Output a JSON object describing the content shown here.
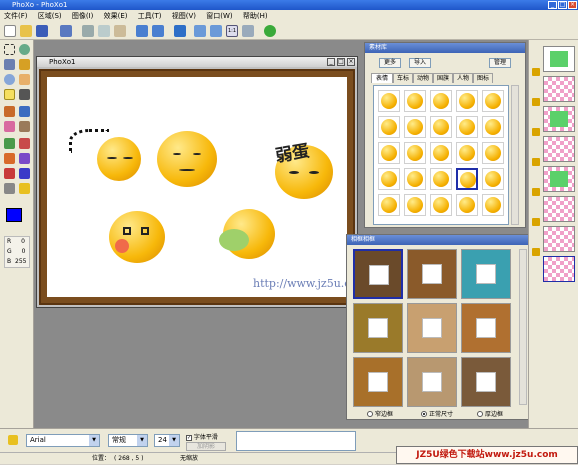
{
  "window": {
    "title": "PhoXo - PhoXo1"
  },
  "menu": [
    "文件(F)",
    "区域(S)",
    "图像(I)",
    "效果(E)",
    "工具(T)",
    "视图(V)",
    "窗口(W)",
    "帮助(H)"
  ],
  "document": {
    "title": "PhoXo1",
    "watermark": "http://www.jz5u.com"
  },
  "colors": {
    "accent": "#2f68d8",
    "frame_wood": "#7a4d1e",
    "face_yellow": "#f7b80a",
    "selection": "#1f2ea8"
  },
  "left_panel": {
    "r_label": "R",
    "r_value": "0",
    "g_label": "G",
    "g_value": "0",
    "b_label": "B",
    "b_value": "255"
  },
  "material_panel": {
    "title": "素材库",
    "buttons": {
      "more": "更多",
      "import": "导入",
      "manage": "管理"
    },
    "tabs": [
      "表情",
      "车标",
      "动物",
      "国旗",
      "人物",
      "图标"
    ]
  },
  "frame_panel": {
    "title": "相框相框",
    "radios": [
      "窄边框",
      "正常尺寸",
      "厚边框"
    ],
    "selected_radio": "正常尺寸"
  },
  "bottom_bar": {
    "font": "Arial",
    "style": "常规",
    "size": "24",
    "smooth_label": "字体平滑",
    "add_shadow_label": "加阴影"
  },
  "status": {
    "position_label": "位置：",
    "position_value": "( 268 , 5 )",
    "zoom": "无缩放"
  },
  "banner": "JZ5U绿色下载站www.jz5u.com"
}
